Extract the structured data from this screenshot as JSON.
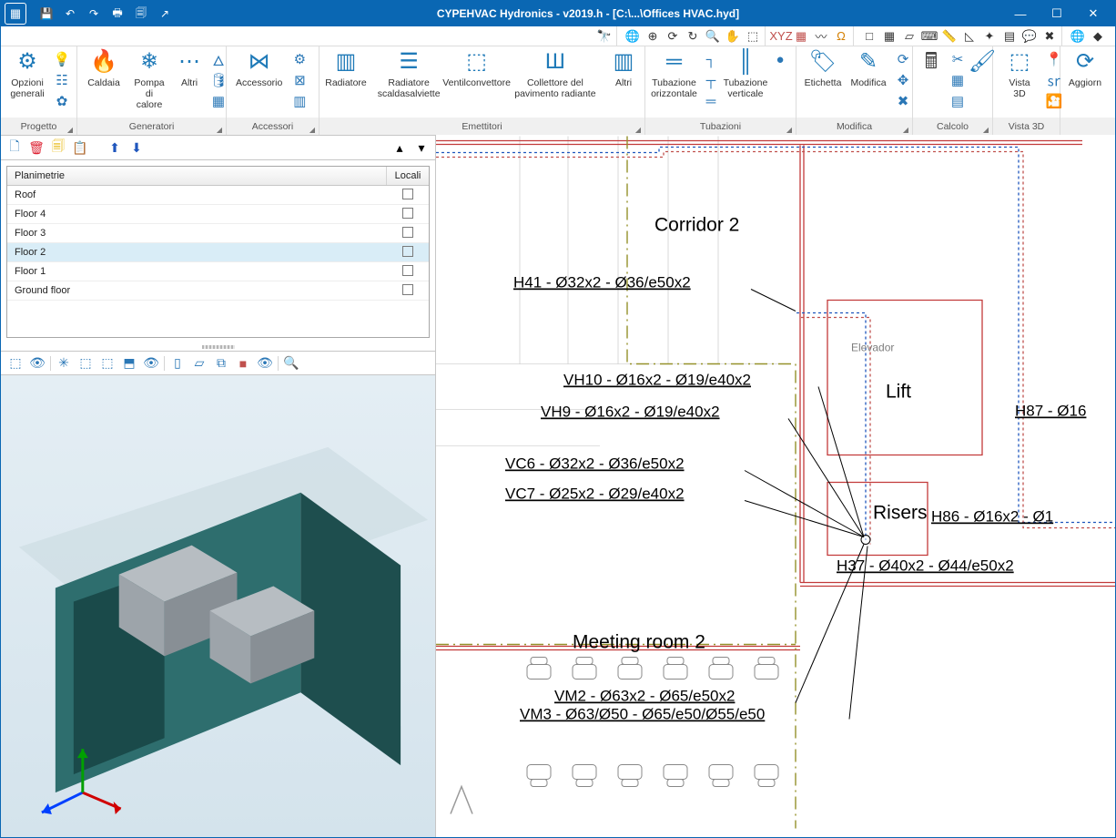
{
  "titlebar": {
    "title": "CYPEHVAC Hydronics - v2019.h - [C:\\...\\Offices HVAC.hyd]"
  },
  "ribbon": {
    "project": {
      "opzioni": "Opzioni generali"
    },
    "generatori": {
      "caldaia": "Caldaia",
      "pompa": "Pompa di calore",
      "altri": "Altri"
    },
    "accessori": {
      "accessorio": "Accessorio"
    },
    "emettitori": {
      "radiatore": "Radiatore",
      "radscald": "Radiatore scaldasalviette",
      "ventil": "Ventilconvettore",
      "collettore": "Collettore del pavimento radiante",
      "altri": "Altri"
    },
    "tubazioni": {
      "horiz": "Tubazione orizzontale",
      "vert": "Tubazione verticale"
    },
    "modifica": {
      "etichetta": "Etichetta",
      "modifica": "Modifica"
    },
    "calcolo": {},
    "vista": {
      "vista3d": "Vista 3D"
    },
    "aggiorna": "Aggiorn"
  },
  "ribbonGroups": {
    "progetto": "Progetto",
    "generatori": "Generatori",
    "accessori": "Accessori",
    "emettitori": "Emettitori",
    "tubazioni": "Tubazioni",
    "modifica": "Modifica",
    "calcolo": "Calcolo",
    "vista3d": "Vista 3D"
  },
  "tree": {
    "header": {
      "col1": "Planimetrie",
      "col2": "Locali"
    },
    "rows": {
      "r0": "Roof",
      "r1": "Floor 4",
      "r2": "Floor 3",
      "r3": "Floor 2",
      "r4": "Floor 1",
      "r5": "Ground floor"
    }
  },
  "drawing": {
    "corridor2": "Corridor 2",
    "lift": "Lift",
    "elevador": "Elevador",
    "risers": "Risers",
    "meeting": "Meeting room 2",
    "H41": "H41 - Ø32x2 - Ø36/e50x2",
    "VH10": "VH10 - Ø16x2 - Ø19/e40x2",
    "VH9": "VH9 - Ø16x2 - Ø19/e40x2",
    "VC6": "VC6 - Ø32x2 - Ø36/e50x2",
    "VC7": "VC7 - Ø25x2 - Ø29/e40x2",
    "H87": "H87 - Ø16",
    "H86": "H86 - Ø16x2 - Ø1",
    "H37": "H37 - Ø40x2 - Ø44/e50x2",
    "VM2": "VM2 - Ø63x2 - Ø65/e50x2",
    "VM3": "VM3 - Ø63/Ø50 - Ø65/e50/Ø55/e50"
  }
}
